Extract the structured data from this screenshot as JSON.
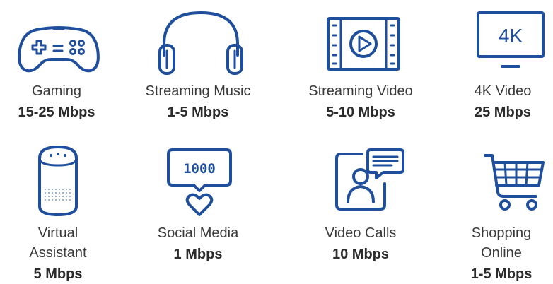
{
  "colors": {
    "icon": "#1f4f9c",
    "text": "#3a3a3a",
    "rate": "#2b2b2b",
    "background": "#ffffff"
  },
  "items": [
    {
      "icon": "gamepad-icon",
      "label": "Gaming",
      "rate": "15-25 Mbps"
    },
    {
      "icon": "headphones-icon",
      "label": "Streaming Music",
      "rate": "1-5 Mbps"
    },
    {
      "icon": "video-film-icon",
      "label": "Streaming Video",
      "rate": "5-10 Mbps"
    },
    {
      "icon": "monitor-4k-icon",
      "label": "4K Video",
      "rate": "25 Mbps",
      "screen_text": "4K"
    },
    {
      "icon": "smart-speaker-icon",
      "label_line1": "Virtual",
      "label_line2": "Assistant",
      "rate": "5 Mbps"
    },
    {
      "icon": "social-like-bubble-icon",
      "label": "Social Media",
      "rate": "1 Mbps",
      "bubble_text": "1000"
    },
    {
      "icon": "video-call-icon",
      "label": "Video Calls",
      "rate": "10 Mbps"
    },
    {
      "icon": "shopping-cart-icon",
      "label_line1": "Shopping",
      "label_line2": "Online",
      "rate": "1-5 Mbps"
    }
  ]
}
